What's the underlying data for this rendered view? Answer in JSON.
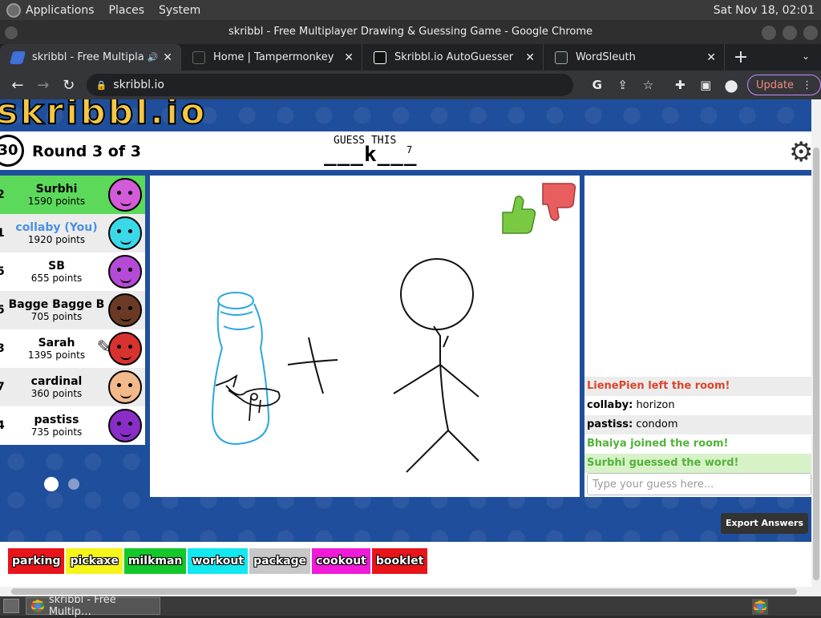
{
  "os_panel": {
    "menus": [
      "Applications",
      "Places",
      "System"
    ],
    "clock": "Sat Nov 18, 02:01"
  },
  "window": {
    "title": "skribbl - Free Multiplayer Drawing & Guessing Game - Google Chrome"
  },
  "tabs": [
    {
      "label": "skribbl - Free Multiplaye",
      "icon": "skribbl-pencil-icon",
      "favicon_color": "#3f6fd8",
      "active": true,
      "audio_icon": "🔊"
    },
    {
      "label": "Home | Tampermonkey",
      "icon": "tampermonkey-icon",
      "favicon_color": "#222222",
      "active": false
    },
    {
      "label": "Skribbl.io AutoGuesser",
      "icon": "greasyfork-icon",
      "favicon_color": "#111111",
      "active": false
    },
    {
      "label": "WordSleuth",
      "icon": "github-icon",
      "favicon_color": "#24292e",
      "active": false
    }
  ],
  "tab_glyphs": {
    "close": "✕",
    "new_tab": "+",
    "tab_menu": "⌄"
  },
  "toolbar": {
    "back": "←",
    "forward": "→",
    "reload": "↻",
    "lock": "🔒",
    "url": "skribbl.io",
    "icons": {
      "google": "G",
      "share": "⇪",
      "star": "☆",
      "extensions": "✚",
      "sidepanel": "▣",
      "profile": "●"
    },
    "update_label": "Update",
    "menu": "⋮"
  },
  "game": {
    "logo": "skribbl.io",
    "logo_color": "#f6c744",
    "timer": "30",
    "round": "Round 3 of 3",
    "guess_label": "GUESS THIS",
    "word_hint": "___k___",
    "word_length": "7",
    "settings_icon": "⚙"
  },
  "players": [
    {
      "rank": "2",
      "name": "Surbhi",
      "points": "1590 points",
      "bg": "#5cd95a",
      "name_color": "#000000",
      "avatar_color": "#d35ad8"
    },
    {
      "rank": "1",
      "name": "collaby (You)",
      "points": "1920 points",
      "bg": "#ececec",
      "name_color": "#4a90e2",
      "avatar_color": "#3ad8e8"
    },
    {
      "rank": "5",
      "name": "SB",
      "points": "655 points",
      "bg": "#ffffff",
      "name_color": "#000000",
      "avatar_color": "#b54ad6"
    },
    {
      "rank": "5",
      "name": "Bagge Bagge B",
      "points": "705 points",
      "bg": "#ececec",
      "name_color": "#000000",
      "avatar_color": "#6b3a24"
    },
    {
      "rank": "3",
      "name": "Sarah",
      "points": "1395 points",
      "bg": "#ffffff",
      "name_color": "#000000",
      "avatar_color": "#d8322f",
      "drawing": true
    },
    {
      "rank": "7",
      "name": "cardinal",
      "points": "360 points",
      "bg": "#ececec",
      "name_color": "#000000",
      "avatar_color": "#f2b98a"
    },
    {
      "rank": "4",
      "name": "pastiss",
      "points": "735 points",
      "bg": "#ffffff",
      "name_color": "#000000",
      "avatar_color": "#8a2cc8"
    }
  ],
  "pencil_icon": "✎",
  "canvas": {
    "like_color": "#7ac943",
    "dislike_color": "#e85d5d",
    "stroke_blue": "#2aa7e0",
    "stroke_black": "#111111"
  },
  "chat": {
    "messages": [
      {
        "author": "",
        "text": "LienePien left the room!",
        "color": "#d9452a",
        "style": "alt"
      },
      {
        "author": "collaby:",
        "text": " horizon",
        "color": "#000000",
        "style": "plain"
      },
      {
        "author": "pastiss:",
        "text": " condom",
        "color": "#000000",
        "style": "alt"
      },
      {
        "author": "",
        "text": "Bhaiya joined the room!",
        "color": "#52b33a",
        "style": "plain"
      },
      {
        "author": "",
        "text": "Surbhi guessed the word!",
        "color": "#52b33a",
        "style": "green"
      }
    ],
    "input_placeholder": "Type your guess here..."
  },
  "export_label": "Export Answers",
  "autoguesser": {
    "words": [
      {
        "text": "parking",
        "color": "#e8141a"
      },
      {
        "text": "pickaxe",
        "color": "#f5f51a"
      },
      {
        "text": "milkman",
        "color": "#12c82a"
      },
      {
        "text": "workout",
        "color": "#12e8f0"
      },
      {
        "text": "package",
        "color": "#c8c8c8"
      },
      {
        "text": "cookout",
        "color": "#f01ad8"
      },
      {
        "text": "booklet",
        "color": "#e8141a"
      }
    ]
  },
  "taskbar": {
    "task": "skribbl - Free Multip…"
  }
}
